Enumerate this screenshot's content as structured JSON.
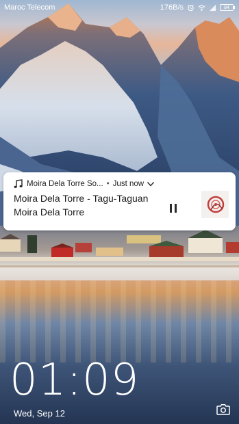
{
  "status_bar": {
    "carrier": "Maroc Telecom",
    "net_speed": "176B/s",
    "battery": "84"
  },
  "notification": {
    "app_name": "Moira Dela Torre So...",
    "separator": "•",
    "time": "Just now",
    "title": "Moira Dela Torre - Tagu-Taguan",
    "artist": "Moira Dela Torre"
  },
  "lockscreen": {
    "time": "01:09",
    "date": "Wed, Sep 12"
  },
  "icons": {
    "note": "music-note-icon",
    "expand": "chevron-down-icon",
    "pause": "pause-icon",
    "camera": "camera-icon",
    "wifi": "wifi-icon",
    "alarm": "alarm-icon"
  }
}
